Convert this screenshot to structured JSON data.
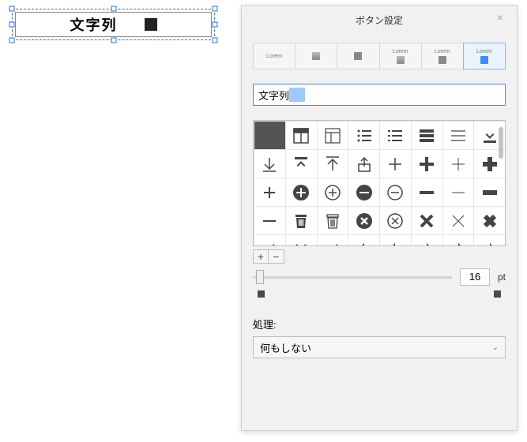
{
  "canvas": {
    "button_label": "文字列"
  },
  "panel": {
    "title": "ボタン設定",
    "style_tabs": [
      {
        "label": "Lorem"
      },
      {
        "label": ""
      },
      {
        "label": ""
      },
      {
        "label": "Lorem"
      },
      {
        "label": "Lorem"
      },
      {
        "label": "Lorem"
      }
    ],
    "text_field_value": "文字列",
    "icons": [
      "filled-square",
      "layout-half",
      "layout-quarter",
      "list-dots",
      "list-lines",
      "menu-bold",
      "menu-thin",
      "download",
      "arrow-down",
      "upload",
      "arrow-up",
      "share-up",
      "plus-outline",
      "plus-bold",
      "plus-thin",
      "plus-heavy",
      "plus-line",
      "circle-plus-fill",
      "circle-plus",
      "circle-minus-fill",
      "circle-minus",
      "minus-bold",
      "minus-thin",
      "minus-heavy",
      "minus-line",
      "trash-fill",
      "trash-outline",
      "circle-x-fill",
      "circle-x",
      "x-bold",
      "x-thin",
      "x-heavy",
      "slash",
      "arrows-misc",
      "arr",
      "arr",
      "arr",
      "arr",
      "arr",
      "arr"
    ],
    "size_value": "16",
    "size_unit": "pt",
    "processing_label": "処理:",
    "processing_value": "何もしない"
  }
}
